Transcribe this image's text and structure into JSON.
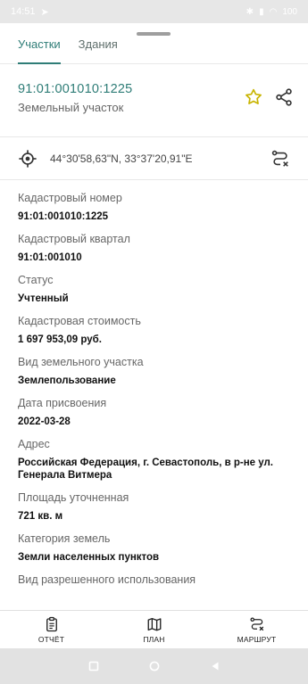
{
  "status_bar": {
    "time": "14:51",
    "battery": "100"
  },
  "tabs": [
    {
      "label": "Участки",
      "active": true
    },
    {
      "label": "Здания",
      "active": false
    }
  ],
  "header": {
    "cadastral_number": "91:01:001010:1225",
    "subtitle": "Земельный участок",
    "star_icon": "star-outline-icon",
    "share_icon": "share-icon"
  },
  "coordinates": "44°30'58,63\"N, 33°37'20,91\"E",
  "fields": [
    {
      "label": "Кадастровый номер",
      "value": "91:01:001010:1225"
    },
    {
      "label": "Кадастровый квартал",
      "value": "91:01:001010"
    },
    {
      "label": "Статус",
      "value": "Учтенный"
    },
    {
      "label": "Кадастровая стоимость",
      "value": "1 697 953,09 руб."
    },
    {
      "label": "Вид земельного участка",
      "value": "Землепользование"
    },
    {
      "label": "Дата присвоения",
      "value": "2022-03-28"
    },
    {
      "label": "Адрес",
      "value": "Российская Федерация, г. Севастополь, в р-не ул. Генерала Витмера"
    },
    {
      "label": "Площадь уточненная",
      "value": "721 кв. м"
    },
    {
      "label": "Категория земель",
      "value": "Земли населенных пунктов"
    },
    {
      "label": "Вид разрешенного использования",
      "value": ""
    }
  ],
  "bottom_nav": {
    "report": "ОТЧЁТ",
    "plan": "ПЛАН",
    "route": "МАРШРУТ"
  },
  "colors": {
    "accent": "#2f7d77",
    "star": "#c8b400"
  }
}
